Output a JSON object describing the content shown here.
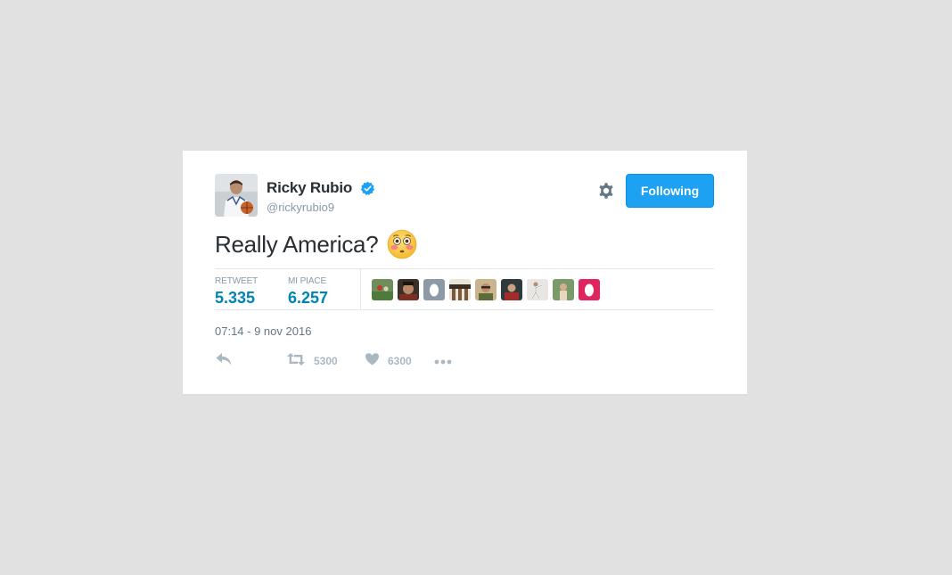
{
  "user": {
    "name": "Ricky Rubio",
    "handle": "@rickyrubio9"
  },
  "follow_button": {
    "label": "Following"
  },
  "tweet": {
    "text": "Really America?"
  },
  "stats": {
    "retweets_label": "RETWEET",
    "retweets_value": "5.335",
    "likes_label": "MI PIACE",
    "likes_value": "6.257"
  },
  "timestamp": "07:14 - 9 nov 2016",
  "actions": {
    "retweet_count": "5300",
    "like_count": "6300"
  },
  "icons": {
    "verified": "verified-badge-icon",
    "gear": "gear-icon",
    "reply": "reply-icon",
    "retweet": "retweet-icon",
    "like": "heart-icon",
    "more": "more-dots-icon",
    "emoji": "flushed-face-emoji"
  },
  "colors": {
    "accent": "#1da1f2",
    "stat_value": "#0084b4",
    "muted": "#8899a6",
    "icon_muted": "#aab8c2",
    "background": "#e1e1e1"
  }
}
